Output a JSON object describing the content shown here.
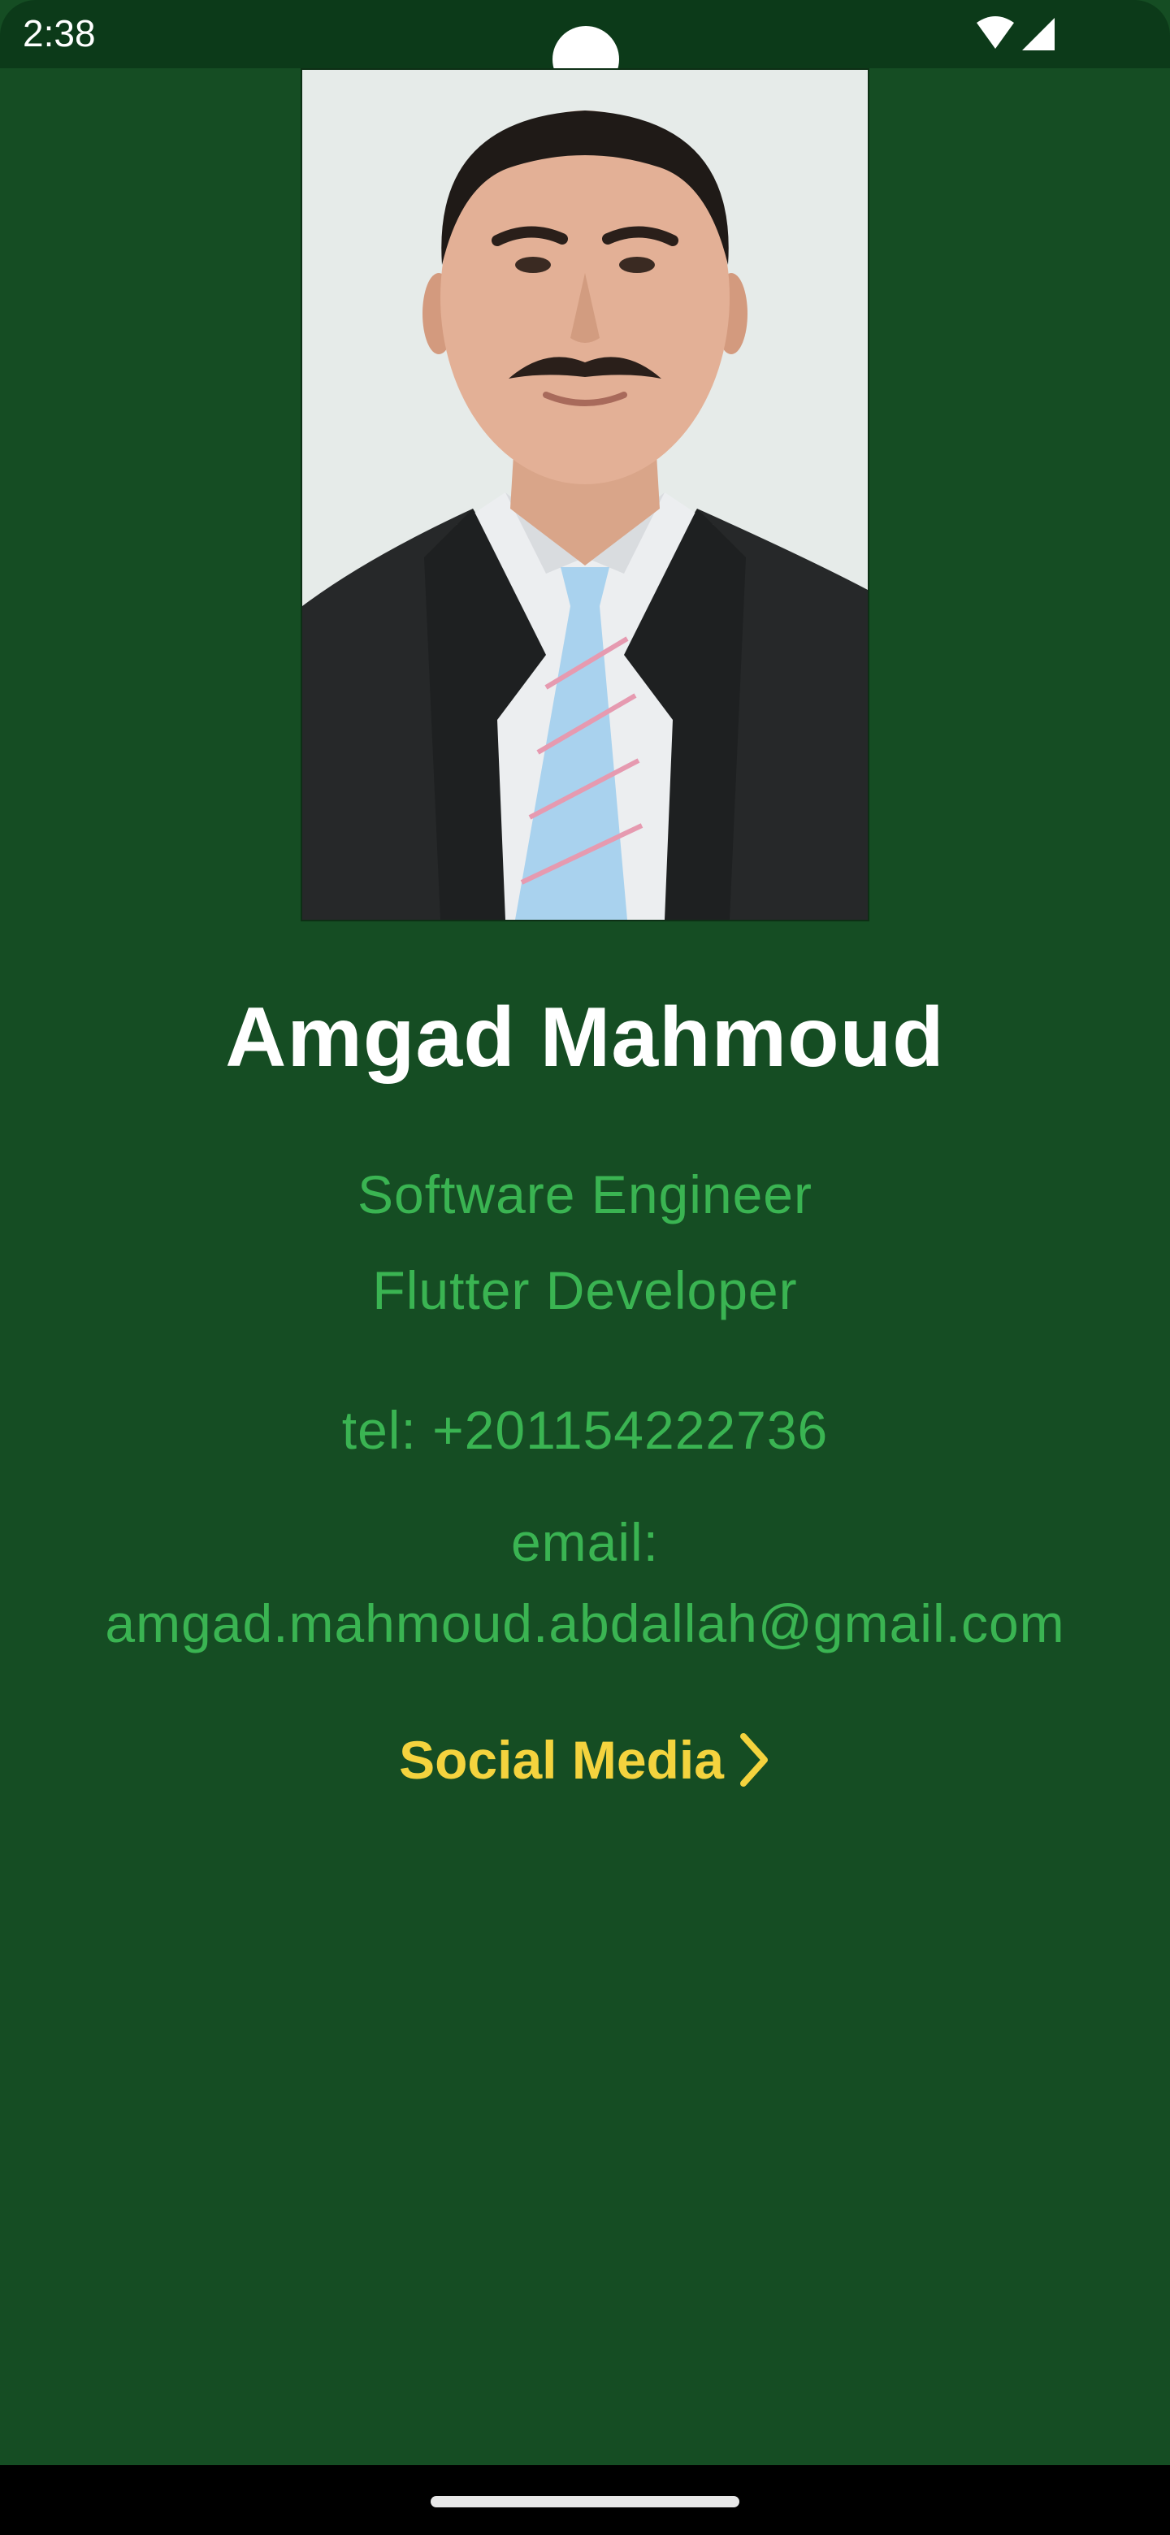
{
  "status_bar": {
    "time": "2:38",
    "icons": [
      "wifi-icon",
      "signal-icon"
    ]
  },
  "profile": {
    "photo_alt": "Amgad Mahmoud",
    "name": "Amgad Mahmoud",
    "titles": [
      "Software Engineer",
      "Flutter Developer"
    ],
    "phone": "tel: +201154222736",
    "email_label": "email:",
    "email_value": "amgad.mahmoud.abdallah@gmail.com"
  },
  "social_link": {
    "label": "Social Media",
    "icon": "chevron-right-icon"
  },
  "colors": {
    "background": "#154d23",
    "status_bar": "#0c3a19",
    "accent_text": "#3ab452",
    "link": "#f4d33e",
    "name": "#ffffff"
  }
}
